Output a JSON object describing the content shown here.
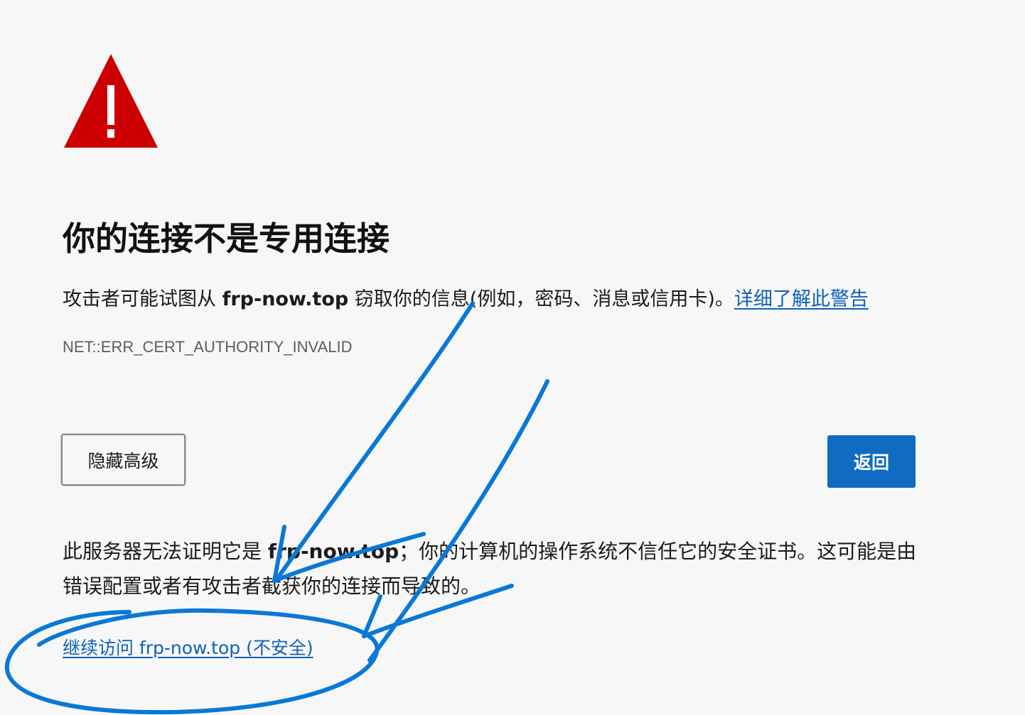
{
  "colors": {
    "background": "#f7f7f7",
    "warning_red": "#cc0000",
    "link_blue": "#0f62b8",
    "button_blue": "#0f6cc2",
    "annotation_blue": "#0a78d7"
  },
  "icon": "warning-triangle-icon",
  "title": "你的连接不是专用连接",
  "description": {
    "prefix": "攻击者可能试图从 ",
    "host": "frp-now.top",
    "suffix": " 窃取你的信息(例如，密码、消息或信用卡)。",
    "learn_more_link": "详细了解此警告"
  },
  "error_code": "NET::ERR_CERT_AUTHORITY_INVALID",
  "buttons": {
    "hide_advanced": "隐藏高级",
    "back": "返回"
  },
  "details": {
    "prefix": "此服务器无法证明它是 ",
    "host": "frp-now.top",
    "suffix": "；你的计算机的操作系统不信任它的安全证书。这可能是由错误配置或者有攻击者截获你的连接而导致的。"
  },
  "proceed_link": "继续访问 frp-now.top (不安全)"
}
